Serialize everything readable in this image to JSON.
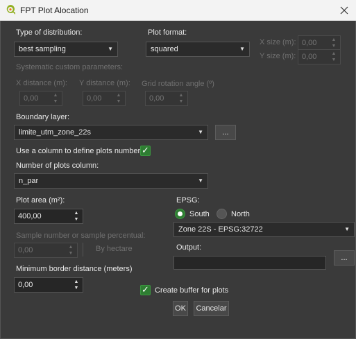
{
  "window": {
    "title": "FPT Plot Alocation"
  },
  "distribution": {
    "label": "Type of distribution:",
    "value": "best sampling"
  },
  "plot_format": {
    "label": "Plot format:",
    "value": "squared"
  },
  "x_size": {
    "label": "X size (m):",
    "value": "0,00"
  },
  "y_size": {
    "label": "Y size (m):",
    "value": "0,00"
  },
  "systematic": {
    "label": "Systematic custom parameters:",
    "x_distance_label": "X distance (m):",
    "x_distance_value": "0,00",
    "y_distance_label": "Y distance (m):",
    "y_distance_value": "0,00",
    "rotation_label": "Grid rotation angle (º)",
    "rotation_value": "0,00"
  },
  "boundary": {
    "label": "Boundary layer:",
    "value": "limite_utm_zone_22s",
    "browse_label": "..."
  },
  "use_column": {
    "label": "Use a column to define plots number",
    "checked": true
  },
  "plots_column": {
    "label": "Number of plots column:",
    "value": "n_par"
  },
  "plot_area": {
    "label": "Plot area (m²):",
    "value": "400,00"
  },
  "epsg": {
    "label": "EPSG:",
    "south_label": "South",
    "north_label": "North",
    "selected": "South",
    "value": "Zone 22S - EPSG:32722"
  },
  "sample": {
    "label": "Sample number or sample percentual:",
    "value": "0,00",
    "by_hectare_label": "By hectare"
  },
  "output": {
    "label": "Output:",
    "value": "",
    "browse_label": "..."
  },
  "min_border": {
    "label": "Minimum border distance (meters)",
    "value": "0,00"
  },
  "buffer": {
    "label": "Create buffer for plots",
    "checked": true
  },
  "buttons": {
    "ok_label": "OK",
    "cancel_label": "Cancelar"
  },
  "colors": {
    "accent": "#2e7d32",
    "background": "#3a3a3a",
    "input": "#262626"
  }
}
